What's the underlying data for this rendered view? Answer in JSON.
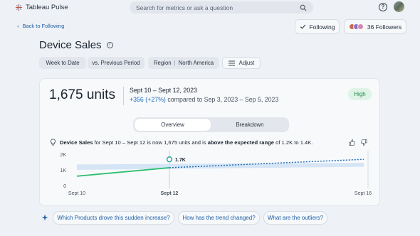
{
  "app": {
    "name": "Tableau Pulse"
  },
  "search": {
    "placeholder": "Search for metrics or ask a question"
  },
  "nav": {
    "back_label": "Back to Following"
  },
  "actions": {
    "following_label": "Following",
    "followers_label": "36 Followers"
  },
  "metric": {
    "title": "Device Sales"
  },
  "filters": [
    {
      "label": "Week to Date"
    },
    {
      "label": "vs. Previous Period"
    },
    {
      "label_prefix": "Region",
      "label_value": "North America"
    },
    {
      "label": "Adjust"
    }
  ],
  "summary": {
    "value": "1,675 units",
    "range": "Sept 10 – Sept 12, 2023",
    "delta": "+356 (+27%)",
    "compare_text": " compared to Sep 3, 2023 – Sep 5, 2023",
    "badge": "High"
  },
  "tabs": [
    {
      "label": "Overview"
    },
    {
      "label": "Breakdown"
    }
  ],
  "insight": {
    "metric": "Device Sales",
    "text_1": " for Sept 10 – Sept 12 is now 1,675 units and is ",
    "emphasis": "above the expected range",
    "text_2": " of 1.2K to 1.4K."
  },
  "chart_data": {
    "type": "line",
    "x": [
      "Sept 10",
      "Sept 12",
      "Sept 16"
    ],
    "y_ticks": [
      "0",
      "1K",
      "2K"
    ],
    "ylim": [
      0,
      2000
    ],
    "series": [
      {
        "values": [
          [
            0,
            600
          ],
          [
            1.3,
            1300
          ],
          [
            2,
            1675
          ]
        ]
      }
    ],
    "expected_range": [
      [
        0,
        1000,
        1350
      ],
      [
        2,
        1200,
        1450
      ]
    ],
    "point_label": "1.7K",
    "colors": {
      "line": "#2fbf71",
      "band": "#cfe2f3",
      "forecast": "#1f6fb8"
    }
  },
  "suggestions": [
    {
      "label": "Which Products drove this sudden increase?"
    },
    {
      "label": "How has the trend changed?"
    },
    {
      "label": "What are the outliers?"
    }
  ],
  "colors": {
    "accent": "#1f5fa8",
    "success": "#1f8a4c",
    "success_bg": "#dff3e7"
  }
}
